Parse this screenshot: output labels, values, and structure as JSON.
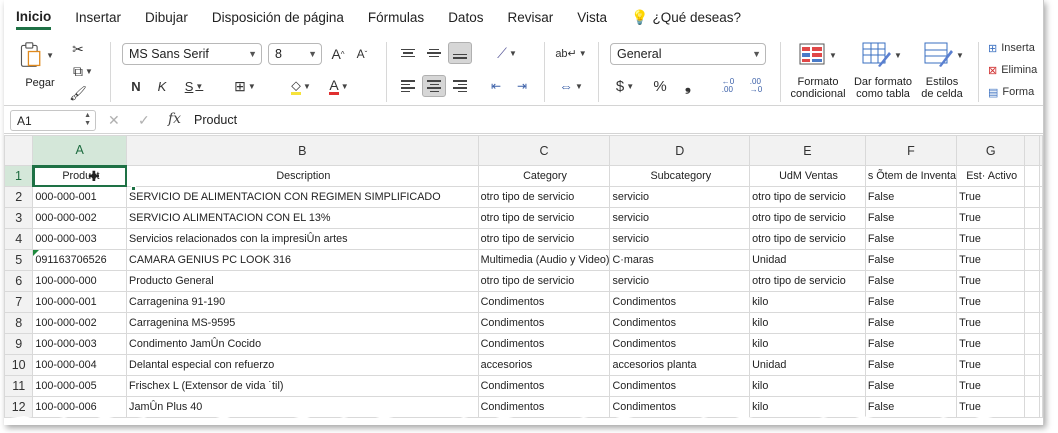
{
  "ribbon_tabs": [
    "Inicio",
    "Insertar",
    "Dibujar",
    "Disposición de página",
    "Fórmulas",
    "Datos",
    "Revisar",
    "Vista"
  ],
  "tell_me": "¿Qué deseas?",
  "clipboard": {
    "paste_label": "Pegar"
  },
  "font": {
    "name": "MS Sans Serif",
    "size": "8"
  },
  "format_bold": "N",
  "format_italic": "K",
  "format_underline": "S",
  "number_format": "General",
  "number_symbols": {
    "currency": "$",
    "percent": "%",
    "comma": "❟",
    "inc_decimal": "←,0 ,00",
    "dec_decimal": ",00 →,0"
  },
  "styles": {
    "conditional": "Formato\ncondicional",
    "as_table": "Dar formato\ncomo tabla",
    "cell_styles": "Estilos\nde celda"
  },
  "cells_group": {
    "insert": "Inserta",
    "delete": "Elimina",
    "format": "Forma"
  },
  "accent_color": "#1e7145",
  "formula_bar": {
    "name_box": "A1",
    "value": "Product",
    "fx": "fx"
  },
  "columns": [
    "A",
    "B",
    "C",
    "D",
    "E",
    "F",
    "G"
  ],
  "header_row": [
    "Product",
    "Description",
    "Category",
    "Subcategory",
    "UdM Ventas",
    "s Õtem de Inventa",
    "Est· Activo"
  ],
  "rows": [
    [
      "000-000-001",
      "SERVICIO DE ALIMENTACION CON REGIMEN SIMPLIFICADO",
      "otro tipo de servicio",
      "servicio",
      "otro tipo de servicio",
      "False",
      "True"
    ],
    [
      "000-000-002",
      "SERVICIO ALIMENTACION CON EL 13%",
      "otro tipo de servicio",
      "servicio",
      "otro tipo de servicio",
      "False",
      "True"
    ],
    [
      "000-000-003",
      "Servicios relacionados con la impresiÛn artes",
      "otro tipo de servicio",
      "servicio",
      "otro tipo de servicio",
      "False",
      "True"
    ],
    [
      "091163706526",
      "CAMARA GENIUS PC LOOK 316",
      "Multimedia (Audio y Video)",
      "C·maras",
      "Unidad",
      "False",
      "True"
    ],
    [
      "100-000-000",
      "Producto General",
      "otro tipo de servicio",
      "servicio",
      "otro tipo de servicio",
      "False",
      "True"
    ],
    [
      "100-000-001",
      "Carragenina 91-190",
      "Condimentos",
      "Condimentos",
      "kilo",
      "False",
      "True"
    ],
    [
      "100-000-002",
      "Carragenina MS-9595",
      "Condimentos",
      "Condimentos",
      "kilo",
      "False",
      "True"
    ],
    [
      "100-000-003",
      "Condimento JamÛn Cocido",
      "Condimentos",
      "Condimentos",
      "kilo",
      "False",
      "True"
    ],
    [
      "100-000-004",
      "Delantal especial con refuerzo",
      "accesorios",
      "accesorios planta",
      "Unidad",
      "False",
      "True"
    ],
    [
      "100-000-005",
      "Frischex L (Extensor de vida ˙til)",
      "Condimentos",
      "Condimentos",
      "kilo",
      "False",
      "True"
    ],
    [
      "100-000-006",
      "JamÛn Plus 40",
      "Condimentos",
      "Condimentos",
      "kilo",
      "False",
      "True"
    ]
  ],
  "row_numbers": [
    "1",
    "2",
    "3",
    "4",
    "5",
    "6",
    "7",
    "8",
    "9",
    "10",
    "11",
    "12"
  ]
}
